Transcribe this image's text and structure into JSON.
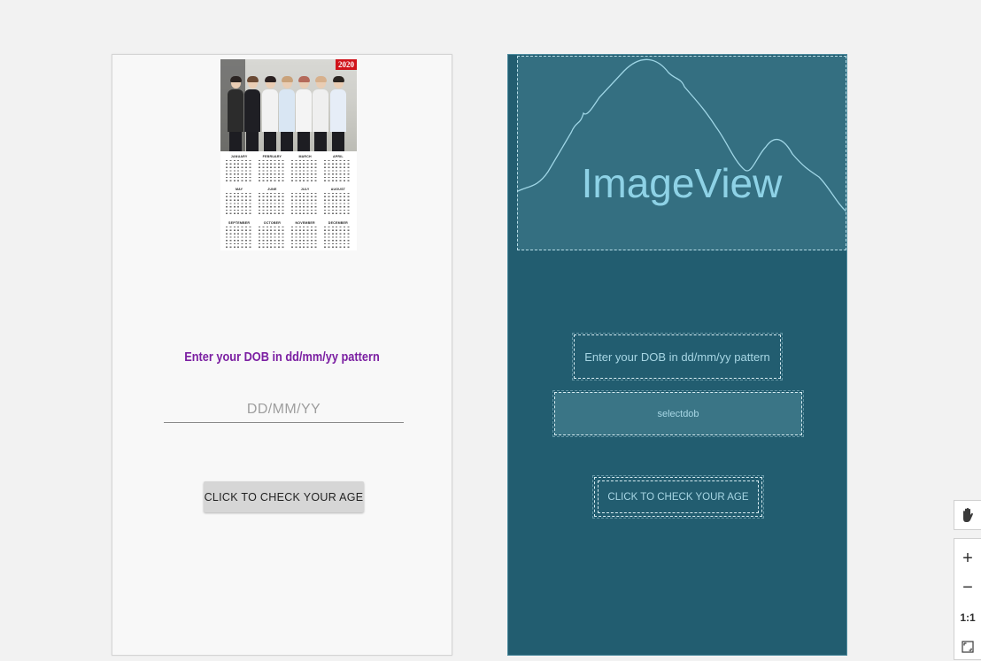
{
  "design": {
    "poster": {
      "badge": "2020",
      "months": [
        "JANUARY",
        "FEBRUARY",
        "MARCH",
        "APRIL",
        "MAY",
        "JUNE",
        "JULY",
        "AUGUST",
        "SEPTEMBER",
        "OCTOBER",
        "NOVEMBER",
        "DECEMBER"
      ]
    },
    "dob_label": "Enter your DOB in dd/mm/yy pattern",
    "dob_input": {
      "value": "",
      "placeholder": "DD/MM/YY"
    },
    "check_button": "CLICK TO CHECK YOUR AGE"
  },
  "blueprint": {
    "image_view": "ImageView",
    "label": "Enter your DOB in dd/mm/yy pattern",
    "select": "selectdob",
    "button": "CLICK TO CHECK YOUR AGE"
  },
  "toolbar": {
    "pan_icon": "hand-icon",
    "zoom_in": "+",
    "zoom_out": "−",
    "actual_size": "1:1",
    "fit_icon": "fit-screen-icon"
  },
  "colors": {
    "accent_text": "#7b1fa2",
    "blueprint_bg": "#225d70",
    "blueprint_text": "#a7d6e4",
    "badge_red": "#d0131b"
  }
}
